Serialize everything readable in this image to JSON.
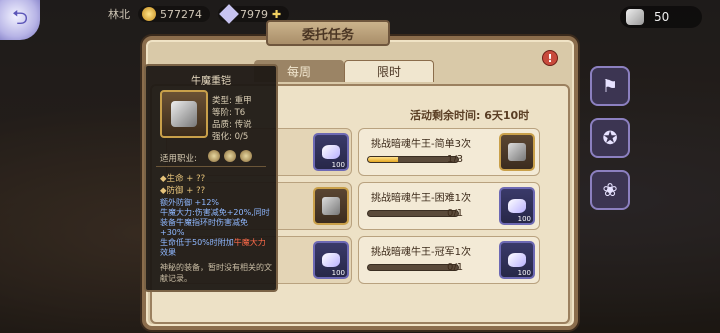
{
  "topbar": {
    "player_name": "林北",
    "gold": "577274",
    "gems": "7979",
    "gems_plus": "✚",
    "extra": "",
    "stone_count": "50"
  },
  "panel": {
    "title": "委托任务",
    "tabs": [
      {
        "label": "每周",
        "active": false
      },
      {
        "label": "限时",
        "active": true
      }
    ],
    "timer": "活动剩余时间: 6天10时"
  },
  "tasks": [
    {
      "name": "挑战暗魂牛王-简单3次",
      "progress": 0.33,
      "progress_text": "1/3",
      "reward_count": "100"
    },
    {
      "name": "挑战暗魂牛王-困难1次",
      "progress": 0.0,
      "progress_text": "0/1",
      "reward_count": "100"
    },
    {
      "name": "挑战暗魂牛王-冠军1次",
      "progress": 0.0,
      "progress_text": "0/1",
      "reward_count": "100"
    }
  ],
  "left_rewards": [
    "100",
    "",
    "100"
  ],
  "tooltip": {
    "title": "牛魔重铠",
    "type": "类型: 重甲",
    "tier": "等阶: T6",
    "quality": "品质: 传说",
    "enhance": "强化: 0/5",
    "job_label": "适用职业:",
    "stat_hp": "◆生命  + ??",
    "stat_def": "◆防御  + ??",
    "effect_1": "额外防御 +12%",
    "effect_2": "牛魔大力:伤害减免+20%,同时装备牛魔指环时伤害减免+30%",
    "effect_3a": "生命低于50%时附加",
    "effect_3b": "牛魔大力",
    "effect_3c": "效果",
    "desc": "神秘的装备，暂时没有相关的文献记录。"
  },
  "side": {
    "icons": [
      "banner-icon",
      "emblem-icon",
      "lotus-icon"
    ]
  }
}
